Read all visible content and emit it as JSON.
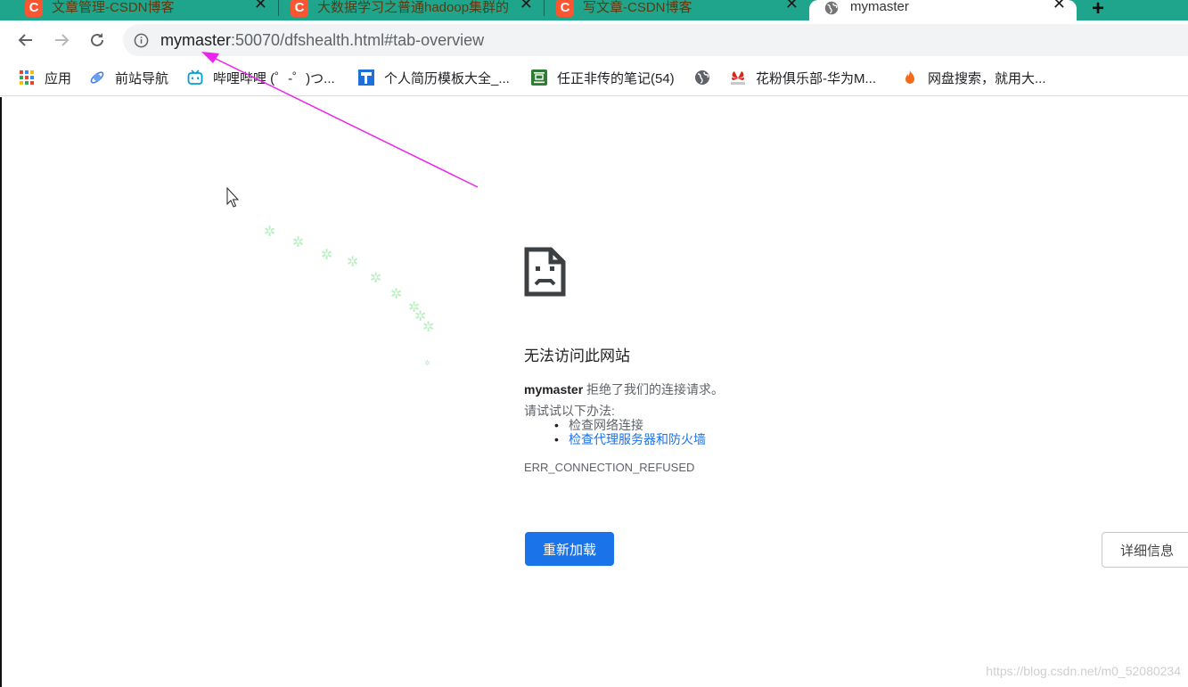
{
  "tabs": [
    {
      "title": "文章管理-CSDN博客",
      "favicon": "C"
    },
    {
      "title": "大数据学习之普通hadoop集群的",
      "favicon": "C"
    },
    {
      "title": "写文章-CSDN博客",
      "favicon": "C"
    },
    {
      "title": "mymaster",
      "favicon": "globe-icon"
    }
  ],
  "toolbar": {
    "url_host": "mymaster",
    "url_rest": ":50070/dfshealth.html#tab-overview"
  },
  "bookmarks": [
    {
      "label": "应用",
      "icon": "apps-grid-icon"
    },
    {
      "label": "前站导航",
      "icon": "planet-icon"
    },
    {
      "label": "哔哩哔哩 (゜-゜)つ...",
      "icon": "bilibili-icon"
    },
    {
      "label": "个人简历模板大全_...",
      "icon": "resume-icon"
    },
    {
      "label": "任正非传的笔记(54)",
      "icon": "douban-icon"
    },
    {
      "label": "",
      "icon": "globe-icon"
    },
    {
      "label": "花粉俱乐部-华为M...",
      "icon": "huawei-icon"
    },
    {
      "label": "网盘搜索，就用大...",
      "icon": "flame-icon"
    }
  ],
  "error": {
    "title": "无法访问此网站",
    "host": "mymaster",
    "description": " 拒绝了我们的连接请求。",
    "suggest_label": "请试试以下办法:",
    "suggestions": [
      "检查网络连接",
      "检查代理服务器和防火墙"
    ],
    "code": "ERR_CONNECTION_REFUSED",
    "reload_label": "重新加载",
    "details_label": "详细信息"
  },
  "watermark": "https://blog.csdn.net/m0_52080234",
  "colors": {
    "tab_strip": "#1fa58c",
    "csdn_favicon": "#fc5531",
    "primary_button": "#1a73e8",
    "link": "#1a73e8",
    "annotation_arrow": "#ee22ee"
  }
}
